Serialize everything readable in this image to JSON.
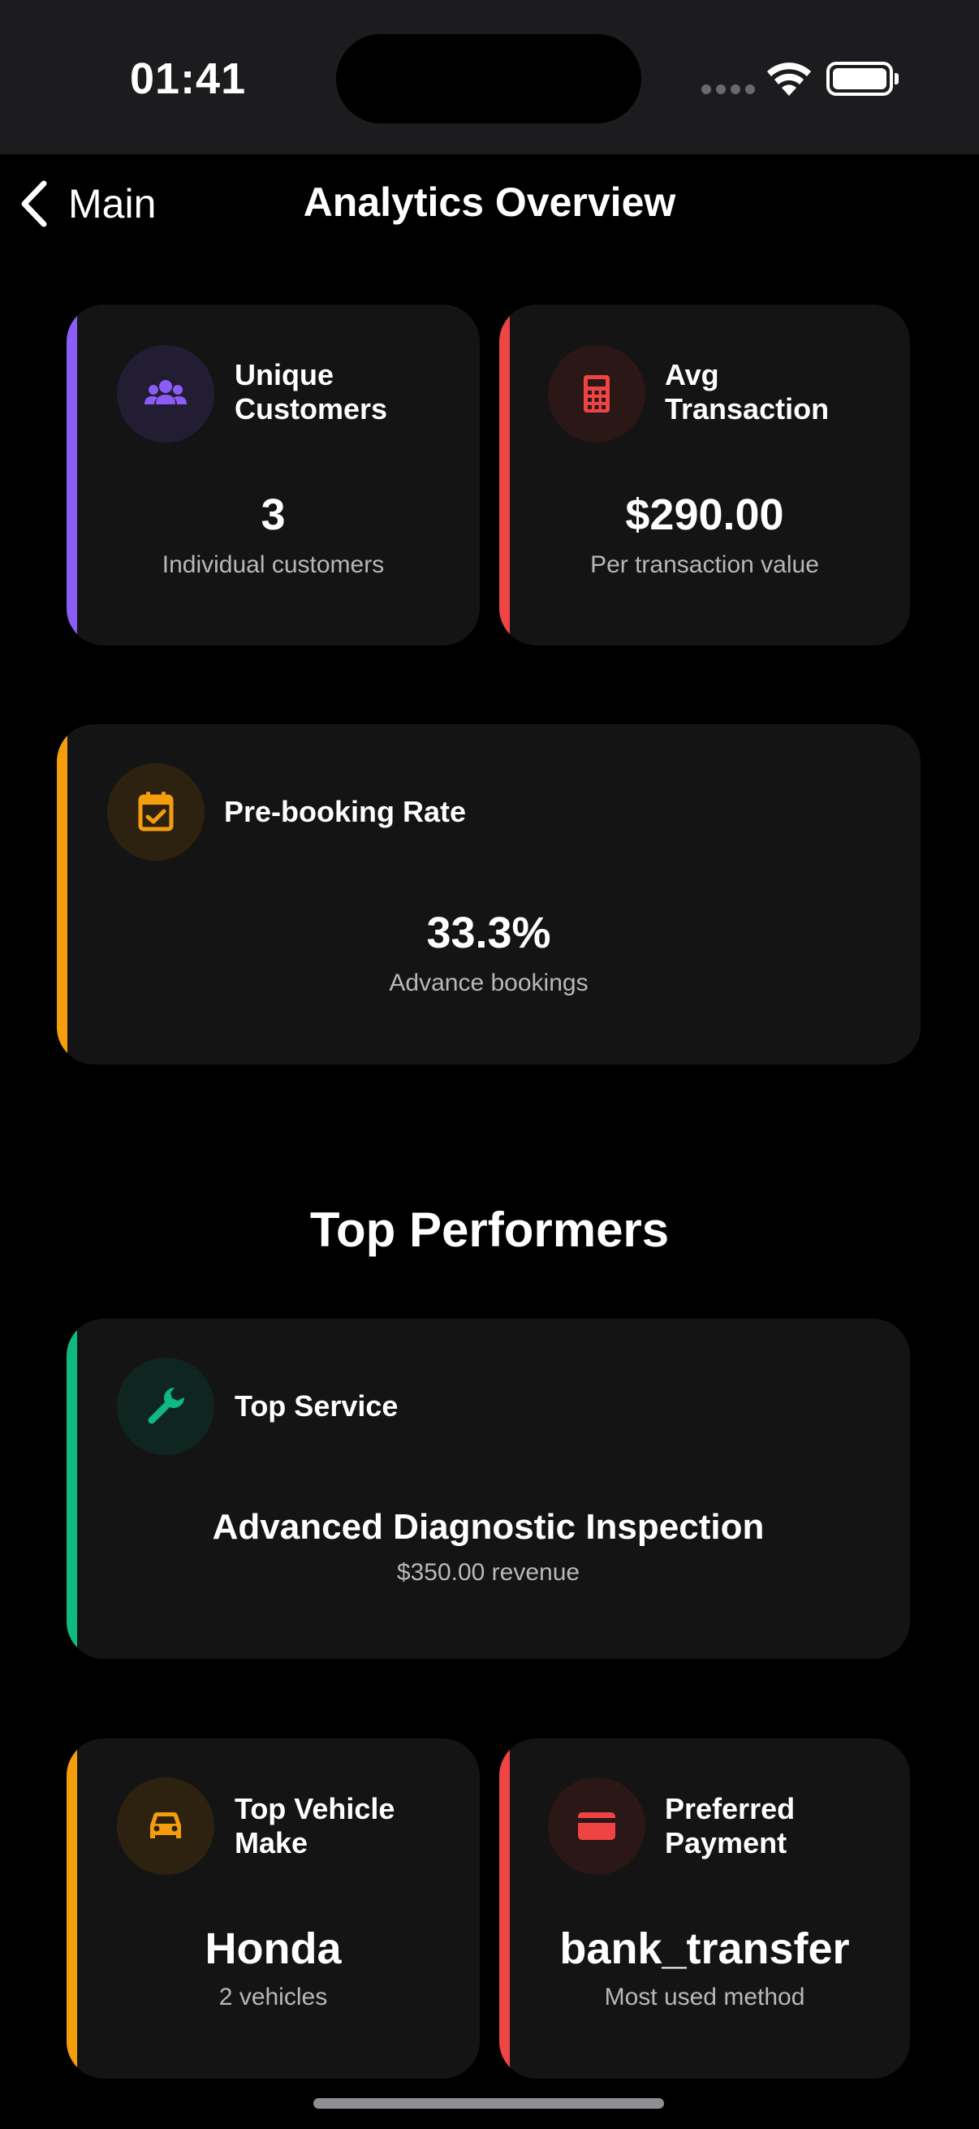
{
  "status_bar": {
    "time": "01:41"
  },
  "nav": {
    "back_label": "Main",
    "title": "Analytics Overview"
  },
  "cards": {
    "unique_customers": {
      "title": "Unique Customers",
      "value": "3",
      "subtitle": "Individual customers",
      "icon": "users-icon",
      "accent": "#8b5cf6"
    },
    "avg_transaction": {
      "title": "Avg Transaction",
      "value": "$290.00",
      "subtitle": "Per transaction value",
      "icon": "calculator-icon",
      "accent": "#ef4444"
    },
    "prebooking_rate": {
      "title": "Pre-booking Rate",
      "value": "33.3%",
      "subtitle": "Advance bookings",
      "icon": "calendar-check-icon",
      "accent": "#f59e0b"
    },
    "top_service": {
      "title": "Top Service",
      "value": "Advanced Diagnostic Inspection",
      "subtitle": "$350.00 revenue",
      "icon": "wrench-icon",
      "accent": "#10b981"
    },
    "top_vehicle_make": {
      "title": "Top Vehicle Make",
      "value": "Honda",
      "subtitle": "2 vehicles",
      "icon": "car-icon",
      "accent": "#f59e0b"
    },
    "preferred_payment": {
      "title": "Preferred Payment",
      "value": "bank_transfer",
      "subtitle": "Most used method",
      "icon": "credit-card-icon",
      "accent": "#ef4444"
    }
  },
  "sections": {
    "top_performers": "Top Performers"
  }
}
